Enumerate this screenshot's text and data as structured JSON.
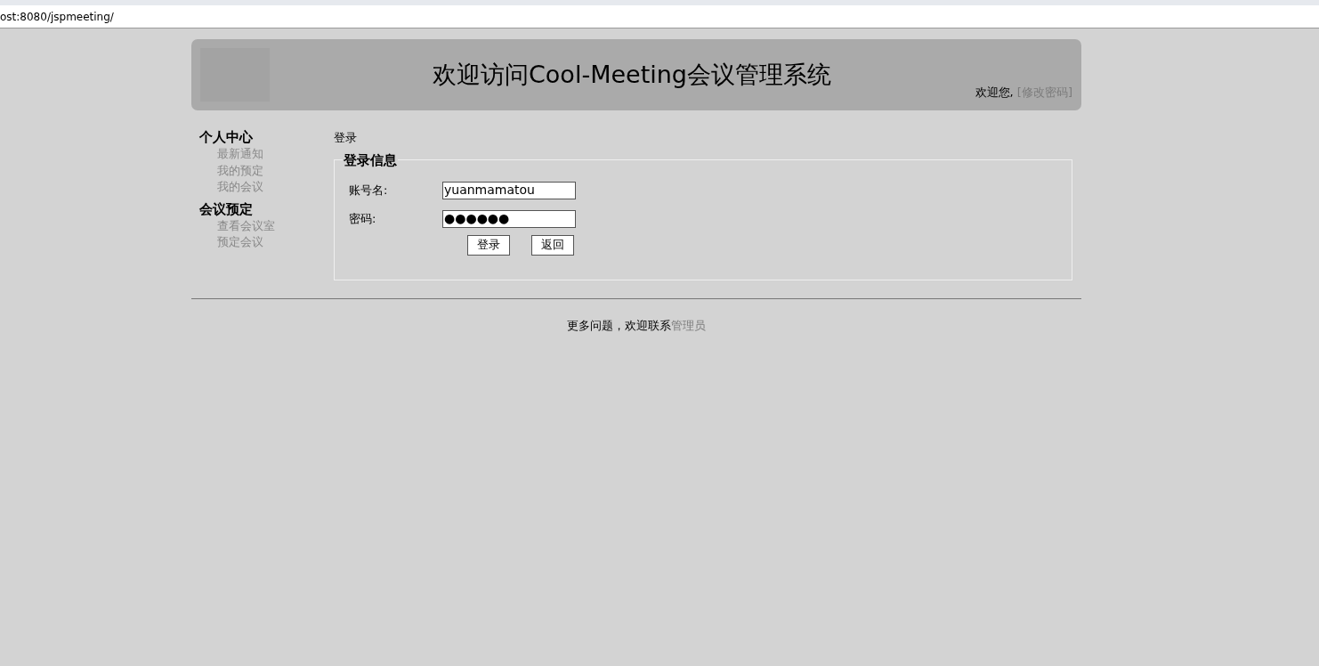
{
  "address_bar": {
    "url": "ost:8080/jspmeeting/"
  },
  "header": {
    "title": "欢迎访问Cool-Meeting会议管理系统",
    "greeting": "欢迎您,",
    "change_password_link": "[修改密码]"
  },
  "sidebar": {
    "sections": [
      {
        "title": "个人中心",
        "items": [
          "最新通知",
          "我的预定",
          "我的会议"
        ]
      },
      {
        "title": "会议预定",
        "items": [
          "查看会议室",
          "预定会议"
        ]
      }
    ]
  },
  "page_title": "登录",
  "login_form": {
    "legend": "登录信息",
    "fields": [
      {
        "label": "账号名:",
        "value": "yuanmamatou"
      },
      {
        "label": "密码:",
        "value": "●●●●●●"
      }
    ],
    "buttons": [
      "登录",
      "返回"
    ]
  },
  "footer": {
    "text": "更多问题，欢迎联系",
    "link": "管理员"
  }
}
